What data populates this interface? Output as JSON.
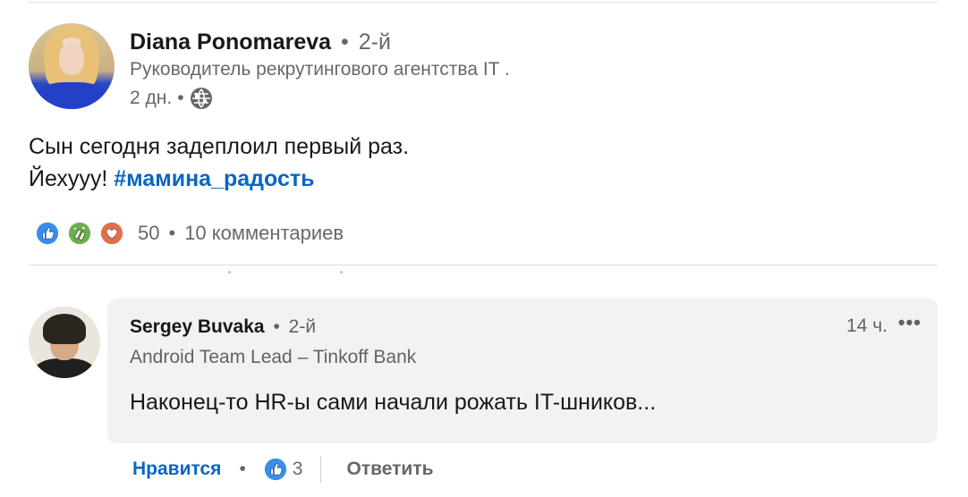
{
  "post": {
    "author": {
      "name": "Diana Ponomareva",
      "degree": "2-й",
      "headline": "Руководитель рекрутингового агентства IT .",
      "time": "2 дн."
    },
    "text_line1": "Сын сегодня задеплоил первый раз.",
    "text_line2": "Йехууу!",
    "hashtag": "#мамина_радость",
    "reactions": {
      "icons": [
        "like-icon",
        "celebrate-icon",
        "love-icon"
      ],
      "count": "50",
      "comments": "10 комментариев"
    }
  },
  "comment": {
    "author": {
      "name": "Sergey Buvaka",
      "degree": "2-й",
      "headline": "Android Team Lead – Tinkoff Bank"
    },
    "time": "14 ч.",
    "more": "•••",
    "text": "Наконец-то HR-ы сами начали рожать IT-шников...",
    "actions": {
      "like_label": "Нравится",
      "like_count": "3",
      "reply_label": "Ответить"
    }
  },
  "separator": "•",
  "colors": {
    "link": "#0a66c2",
    "like": "#378fe9",
    "celebrate": "#44712e",
    "love": "#df704d",
    "comment_bg": "#f2f2f2"
  }
}
